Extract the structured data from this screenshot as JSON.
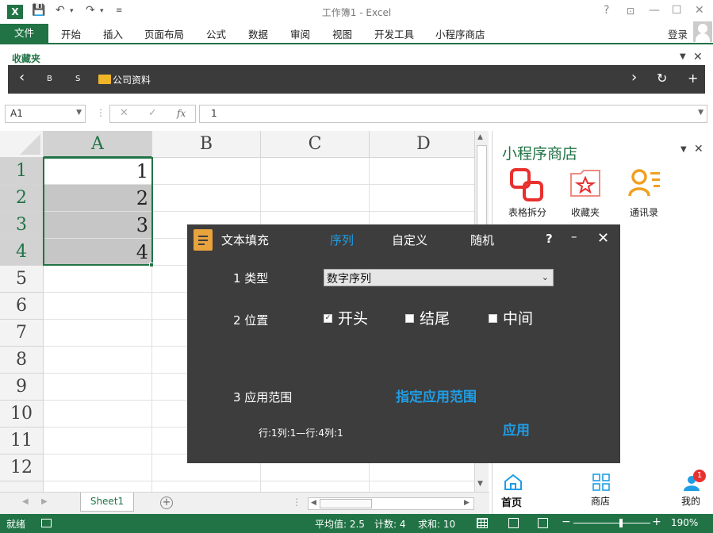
{
  "app": {
    "title": "工作簿1 - Excel"
  },
  "window": {
    "help": "?",
    "minimize": "—",
    "restore": "☐",
    "close": "✕"
  },
  "ribbon": {
    "file": "文件",
    "tabs": [
      "开始",
      "插入",
      "页面布局",
      "公式",
      "数据",
      "审阅",
      "视图",
      "开发工具",
      "小程序商店"
    ],
    "login": "登录"
  },
  "favorites": {
    "title": "收藏夹",
    "buttons": {
      "back": "‹",
      "b": "B",
      "s": "S",
      "forward": "›",
      "refresh": "↻",
      "add": "+"
    },
    "folder": "公司资料"
  },
  "formula_bar": {
    "name_box": "A1",
    "cancel": "✕",
    "enter": "✓",
    "fx": "fx",
    "value": "1"
  },
  "grid": {
    "columns": [
      "A",
      "B",
      "C",
      "D"
    ],
    "rows": [
      "1",
      "2",
      "3",
      "4",
      "5",
      "6",
      "7",
      "8",
      "9",
      "10",
      "11",
      "12"
    ],
    "values": [
      "1",
      "2",
      "3",
      "4"
    ]
  },
  "sheets": {
    "active": "Sheet1",
    "add": "+"
  },
  "status": {
    "ready": "就绪",
    "average": "平均值: 2.5",
    "count": "计数: 4",
    "sum": "求和: 10",
    "zoom": "190%"
  },
  "panel": {
    "title": "小程序商店",
    "apps": [
      "表格拆分",
      "收藏夹",
      "通讯录"
    ],
    "nav": [
      "首页",
      "商店",
      "我的"
    ],
    "badge": "1"
  },
  "dialog": {
    "title": "文本填充",
    "tabs": [
      "序列",
      "自定义",
      "随机"
    ],
    "help": "?",
    "minimize": "–",
    "close": "✕",
    "type_label": "1 类型",
    "type_value": "数字序列",
    "position_label": "2 位置",
    "positions": [
      "开头",
      "结尾",
      "中间"
    ],
    "range_label": "3 应用范围",
    "range_button": "指定应用范围",
    "range_info": "行:1列:1—行:4列:1",
    "apply": "应用"
  },
  "colors": {
    "excel_green": "#217346",
    "dialog_bg": "#3d3d3d",
    "accent_blue": "#1f9ee6",
    "badge_red": "#e8312f"
  }
}
